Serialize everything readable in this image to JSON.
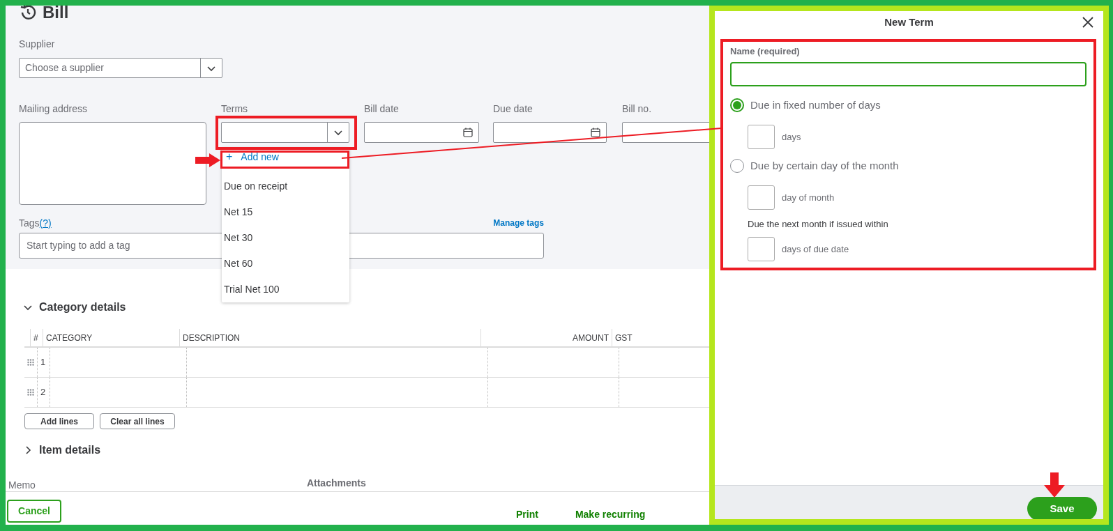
{
  "page": {
    "title": "Bill"
  },
  "supplier": {
    "label": "Supplier",
    "placeholder": "Choose a supplier"
  },
  "fields": [
    {
      "label": "Mailing address",
      "kind": "textarea"
    },
    {
      "label": "Terms",
      "kind": "select"
    },
    {
      "label": "Bill date",
      "kind": "date"
    },
    {
      "label": "Due date",
      "kind": "date"
    },
    {
      "label": "Bill no.",
      "kind": "text"
    }
  ],
  "terms_menu": {
    "add_icon": "+",
    "add_label": "Add new",
    "items": [
      "Due on receipt",
      "Net 15",
      "Net 30",
      "Net 60",
      "Trial Net 100"
    ]
  },
  "tags": {
    "label": "Tags",
    "help": "(?)",
    "manage": "Manage tags",
    "placeholder": "Start typing to add a tag"
  },
  "category_section": {
    "title": "Category details",
    "expanded": true,
    "columns": [
      {
        "label": "#",
        "kind": "text"
      },
      {
        "label": "CATEGORY",
        "kind": "text"
      },
      {
        "label": "DESCRIPTION",
        "kind": "text"
      },
      {
        "label": "AMOUNT",
        "kind": "numeric"
      },
      {
        "label": "GST",
        "kind": "text"
      }
    ],
    "rows": [
      {
        "number": "1"
      },
      {
        "number": "2"
      }
    ],
    "buttons": [
      "Add lines",
      "Clear all lines"
    ]
  },
  "item_section": {
    "title": "Item details",
    "expanded": false
  },
  "memo_label": "Memo",
  "attachments_label": "Attachments",
  "footer": {
    "cancel": "Cancel",
    "links": [
      "Print",
      "Make recurring"
    ]
  },
  "new_term": {
    "title": "New Term",
    "name_label": "Name (required)",
    "options": [
      {
        "label": "Due in fixed number of days",
        "selected": true,
        "fields": [
          {
            "unit": "days"
          }
        ]
      },
      {
        "label": "Due by certain day of the month",
        "selected": false,
        "fields": [
          {
            "unit": "day of month"
          },
          {
            "caption": "Due the next month if issued within",
            "unit": "days of due date"
          }
        ]
      }
    ],
    "save": "Save"
  }
}
